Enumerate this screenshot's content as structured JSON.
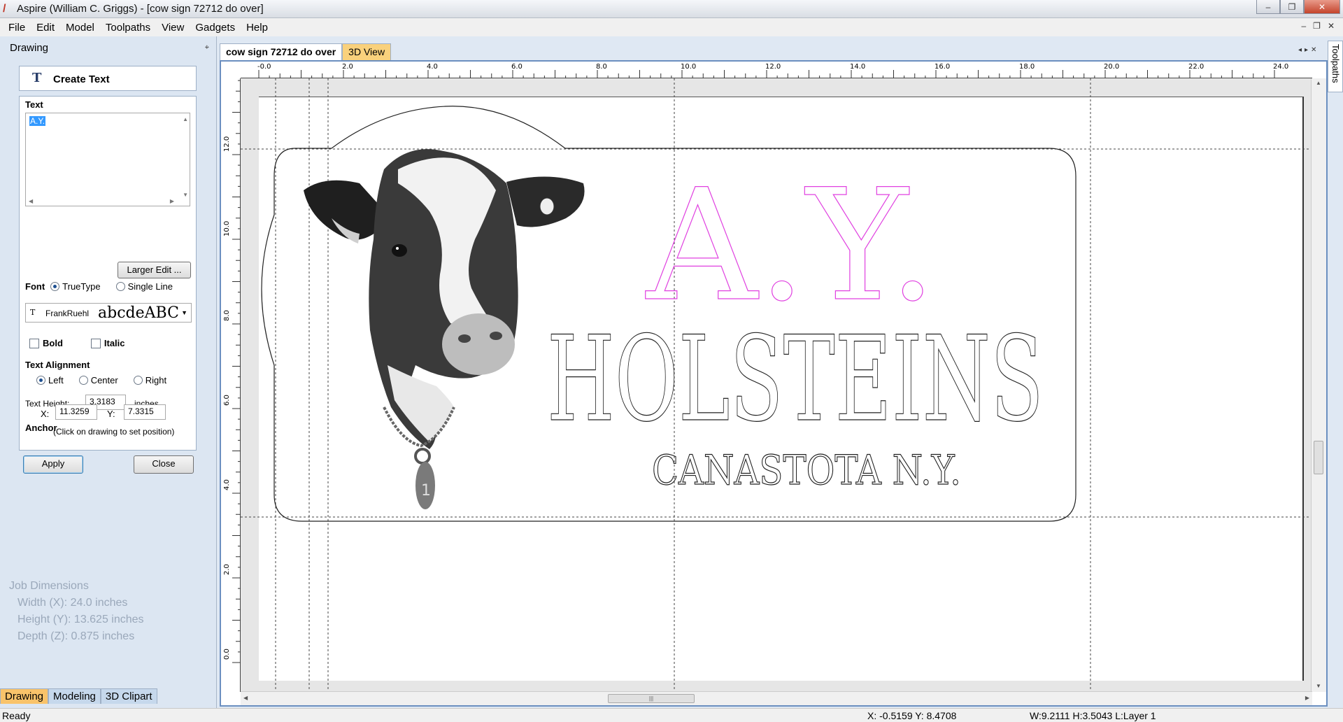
{
  "window": {
    "title": "Aspire (William C. Griggs) - [cow sign 72712 do over]",
    "controls": [
      "‒",
      "❐",
      "✕"
    ]
  },
  "menu": [
    "File",
    "Edit",
    "Model",
    "Toolpaths",
    "View",
    "Gadgets",
    "Help"
  ],
  "menu_right": [
    "‒",
    "❐",
    "✕"
  ],
  "panel": {
    "title": "Drawing",
    "pin": "⌖",
    "tool_title": "Create Text",
    "text_section": "Text",
    "text_value": "A.Y.",
    "larger_edit": "Larger Edit ...",
    "font_label": "Font",
    "font_truetype": "TrueType",
    "font_singleline": "Single Line",
    "font_name": "FrankRuehl",
    "font_sample": "abcdeABC",
    "bold": "Bold",
    "italic": "Italic",
    "alignment_label": "Text Alignment",
    "align_left": "Left",
    "align_center": "Center",
    "align_right": "Right",
    "height_label": "Text Height:",
    "height_value": "3.3183",
    "height_units": "inches",
    "anchor_label": "Anchor",
    "anchor_x_label": "X:",
    "anchor_x": "11.3259",
    "anchor_y_label": "Y:",
    "anchor_y": "7.3315",
    "anchor_hint": "(Click on drawing to set position)",
    "apply": "Apply",
    "close": "Close"
  },
  "job_dimensions": {
    "title": "Job Dimensions",
    "width": "Width  (X): 24.0 inches",
    "height": "Height (Y): 13.625 inches",
    "depth": "Depth  (Z): 0.875 inches"
  },
  "bottom_tabs": [
    "Drawing",
    "Modeling",
    "3D Clipart"
  ],
  "doc_tabs": [
    "cow sign 72712 do over",
    "3D View"
  ],
  "doc_nav": "◂▸✕",
  "side_tab": "Toolpaths",
  "ruler": {
    "top_labels": [
      "-0.0",
      "2.0",
      "4.0",
      "6.0",
      "8.0",
      "10.0",
      "12.0",
      "14.0",
      "16.0",
      "18.0",
      "20.0",
      "22.0",
      "24.0"
    ],
    "left_labels": [
      "12.0",
      "10.0",
      "8.0",
      "6.0",
      "4.0",
      "2.0",
      "0.0"
    ]
  },
  "drawing": {
    "line1": "A.Y.",
    "line2": "HOLSTEINS",
    "line3": "CANASTOTA N.Y.",
    "tag_number": "1",
    "accent": "#e040e0"
  },
  "status": {
    "ready": "Ready",
    "xy": "X: -0.5159 Y:  8.4708",
    "wh": "W:9.2111   H:3.5043  L:Layer 1"
  }
}
